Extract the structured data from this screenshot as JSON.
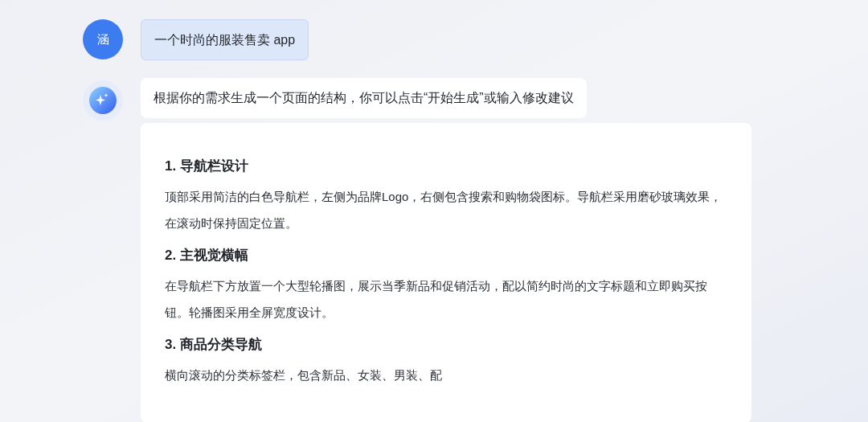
{
  "user_message": {
    "avatar_text": "涵",
    "text": "一个时尚的服装售卖 app"
  },
  "assistant": {
    "intro": "根据你的需求生成一个页面的结构，你可以点击“开始生成”或输入修改建议",
    "sections": [
      {
        "heading": "1. 导航栏设计",
        "body": "顶部采用简洁的白色导航栏，左侧为品牌Logo，右侧包含搜索和购物袋图标。导航栏采用磨砂玻璃效果，在滚动时保持固定位置。"
      },
      {
        "heading": "2. 主视觉横幅",
        "body": "在导航栏下方放置一个大型轮播图，展示当季新品和促销活动，配以简约时尚的文字标题和立即购买按钮。轮播图采用全屏宽度设计。"
      },
      {
        "heading": "3. 商品分类导航",
        "body": "横向滚动的分类标签栏，包含新品、女装、男装、配"
      }
    ]
  }
}
